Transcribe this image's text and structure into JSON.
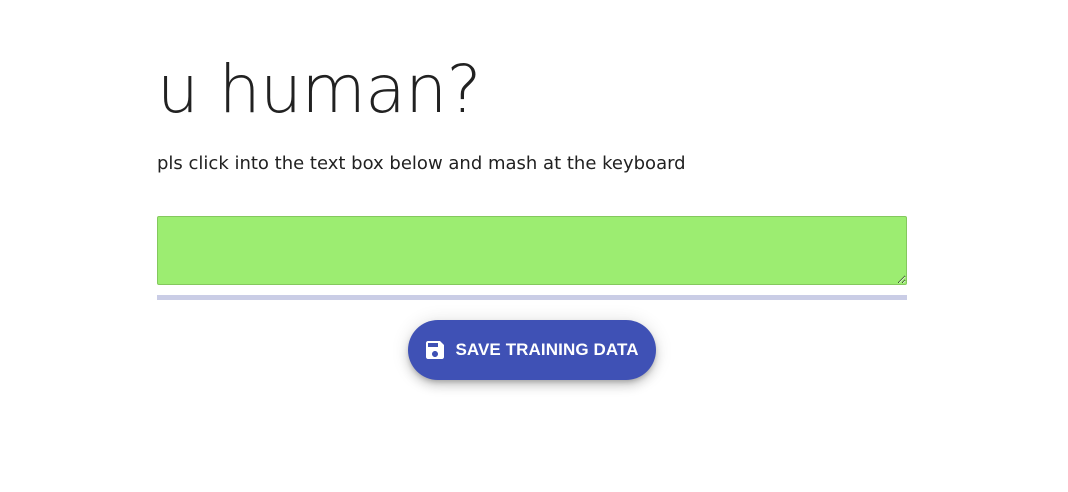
{
  "header": {
    "title": "u human?",
    "instructions": "pls click into the text box below and mash at the keyboard"
  },
  "mash_input": {
    "value": "",
    "status_color": "#9ced71"
  },
  "progress": {
    "fraction": 0,
    "track_color": "#cacde6",
    "fill_color": "#3f51b5"
  },
  "save_button": {
    "label": "SAVE TRAINING DATA",
    "icon": "floppy-disk-icon",
    "color": "#3f51b5"
  }
}
